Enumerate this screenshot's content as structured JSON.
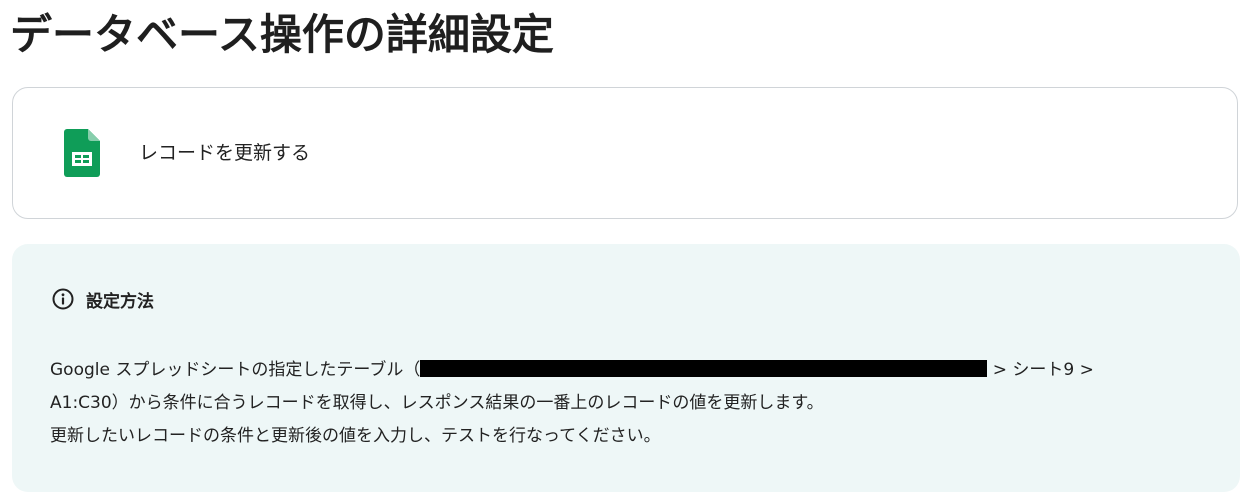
{
  "page": {
    "title": "データベース操作の詳細設定"
  },
  "action": {
    "label": "レコードを更新する",
    "icon": "google-sheets-icon",
    "icon_color": "#0f9d58"
  },
  "info": {
    "icon": "info-circle-icon",
    "title": "設定方法",
    "line1_before": "Google スプレッドシートの指定したテーブル（",
    "line1_after": " > シート9 >",
    "line2": "A1:C30）から条件に合うレコードを取得し、レスポンス結果の一番上のレコードの値を更新します。",
    "line3": "更新したいレコードの条件と更新後の値を入力し、テストを行なってください。",
    "background": "#eef7f7"
  }
}
